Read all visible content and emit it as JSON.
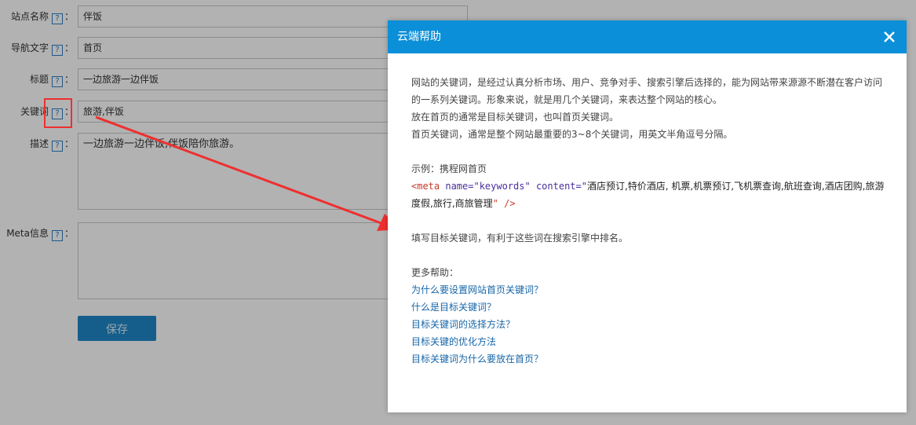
{
  "form": {
    "fields": [
      {
        "label": "站点名称",
        "value": "伴饭"
      },
      {
        "label": "导航文字",
        "value": "首页"
      },
      {
        "label": "标题",
        "value": "一边旅游一边伴饭"
      },
      {
        "label": "关键词",
        "value": "旅游,伴饭"
      },
      {
        "label": "描述",
        "value": "一边旅游一边伴饭,伴饭陪你旅游。"
      },
      {
        "label": "Meta信息",
        "value": ""
      }
    ],
    "help_mark": "?",
    "colon": "：",
    "save_label": "保存"
  },
  "dialog": {
    "title": "云端帮助",
    "close_icon": "close-icon",
    "paragraph1": "网站的关键词，是经过认真分析市场、用户、竞争对手、搜索引擎后选择的，能为网站带来源源不断潜在客户访问的一系列关键词。形象来说，就是用几个关键词，来表达整个网站的核心。",
    "paragraph2": "放在首页的通常是目标关键词，也叫首页关键词。",
    "paragraph3": "首页关键词，通常是整个网站最重要的3~8个关键词，用英文半角逗号分隔。",
    "example_label": "示例：携程网首页",
    "example_code": {
      "open": "<meta",
      "attr1": " name=\"keywords\"",
      "attr2": " content=\"",
      "content": "酒店预订,特价酒店, 机票,机票预订,飞机票查询,航班查询,酒店团购,旅游度假,旅行,商旅管理",
      "close": "\" />"
    },
    "tip": "填写目标关键词，有利于这些词在搜索引擎中排名。",
    "more_help_label": "更多帮助：",
    "links": [
      "为什么要设置网站首页关键词？",
      "什么是目标关键词？",
      "目标关键词的选择方法？",
      "目标关键的优化方法",
      "目标关键词为什么要放在首页？"
    ]
  },
  "colors": {
    "header": "#0b8fd8",
    "link": "#1766a8",
    "annotation": "#ee2f2f"
  }
}
